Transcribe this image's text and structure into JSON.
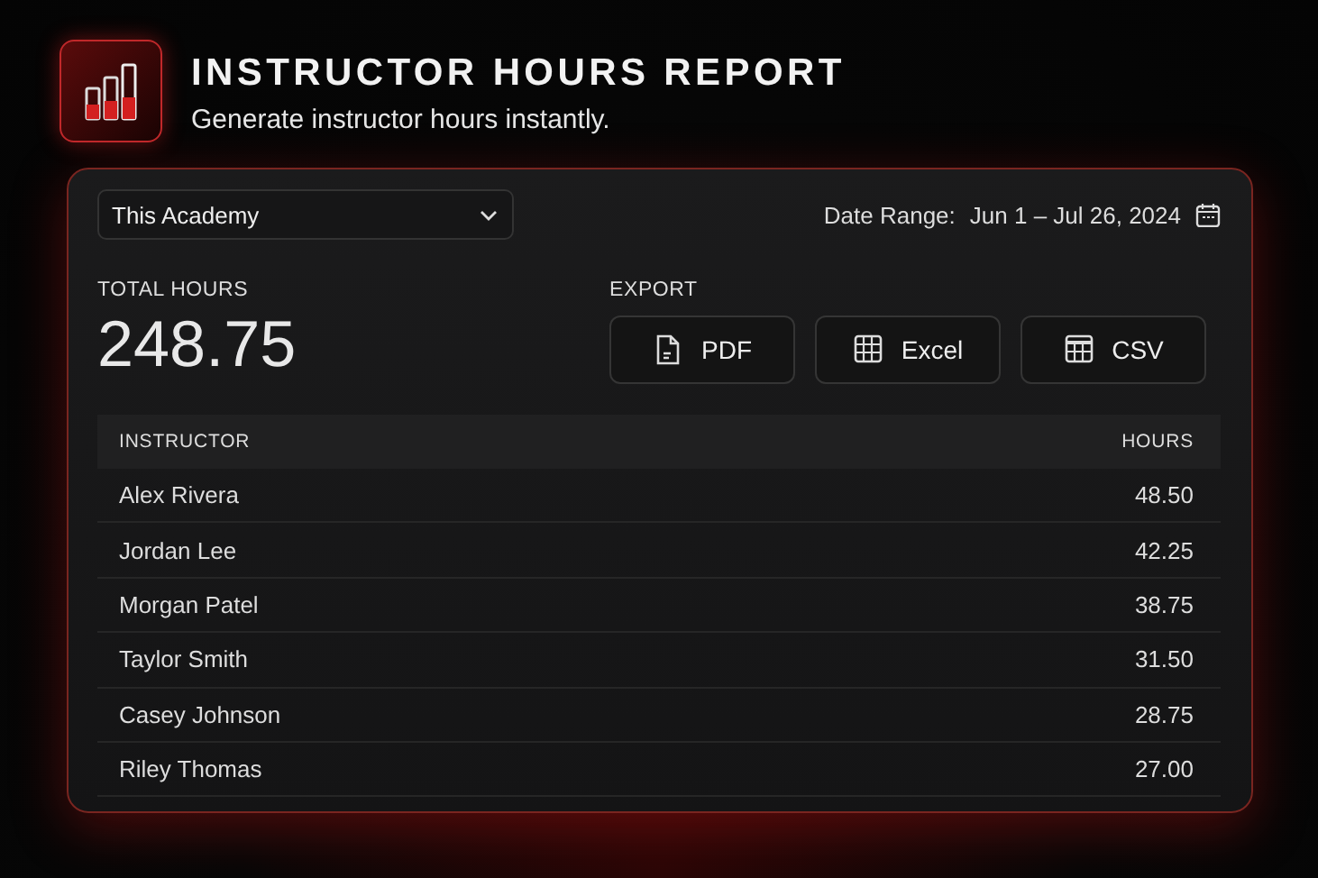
{
  "header": {
    "title": "INSTRUCTOR HOURS REPORT",
    "subtitle": "Generate instructor hours instantly."
  },
  "filter": {
    "value": "This Academy"
  },
  "date_range": {
    "label": "Date Range:",
    "value": "Jun 1 – Jul 26, 2024"
  },
  "total": {
    "label": "TOTAL HOURS",
    "value": "248.75"
  },
  "export": {
    "label": "EXPORT",
    "buttons": [
      {
        "label": "PDF",
        "kind": "document"
      },
      {
        "label": "Excel",
        "kind": "grid"
      },
      {
        "label": "CSV",
        "kind": "table"
      }
    ]
  },
  "table": {
    "columns": [
      "INSTRUCTOR",
      "HOURS"
    ],
    "rows": [
      [
        "Alex Rivera",
        "48.50"
      ],
      [
        "Jordan Lee",
        "42.25"
      ],
      [
        "Morgan Patel",
        "38.75"
      ],
      [
        "Taylor Smith",
        "31.50"
      ],
      [
        "Casey Johnson",
        "28.75"
      ],
      [
        "Riley Thomas",
        "27.00"
      ]
    ]
  }
}
